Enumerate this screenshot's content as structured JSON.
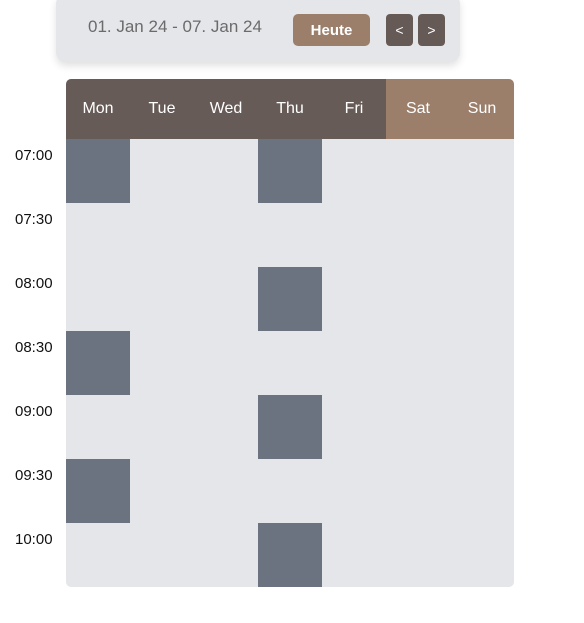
{
  "toolbar": {
    "date_range": "01. Jan 24 - 07. Jan 24",
    "today_label": "Heute",
    "prev_label": "<",
    "next_label": ">"
  },
  "days": [
    "Mon",
    "Tue",
    "Wed",
    "Thu",
    "Fri",
    "Sat",
    "Sun"
  ],
  "times": [
    "07:00",
    "07:30",
    "08:00",
    "08:30",
    "09:00",
    "09:30",
    "10:00"
  ],
  "events": [
    {
      "day": "Mon",
      "start": "07:00"
    },
    {
      "day": "Thu",
      "start": "07:00"
    },
    {
      "day": "Thu",
      "start": "08:00"
    },
    {
      "day": "Mon",
      "start": "08:30"
    },
    {
      "day": "Thu",
      "start": "09:00"
    },
    {
      "day": "Mon",
      "start": "09:30"
    },
    {
      "day": "Thu",
      "start": "10:00"
    }
  ],
  "colors": {
    "weekday_header": "#675b57",
    "weekend_header": "#9b7f6b",
    "grid_background": "#e5e6ea",
    "event": "#6b7280",
    "today_button": "#9b7f6b",
    "nav_button": "#655a56"
  }
}
